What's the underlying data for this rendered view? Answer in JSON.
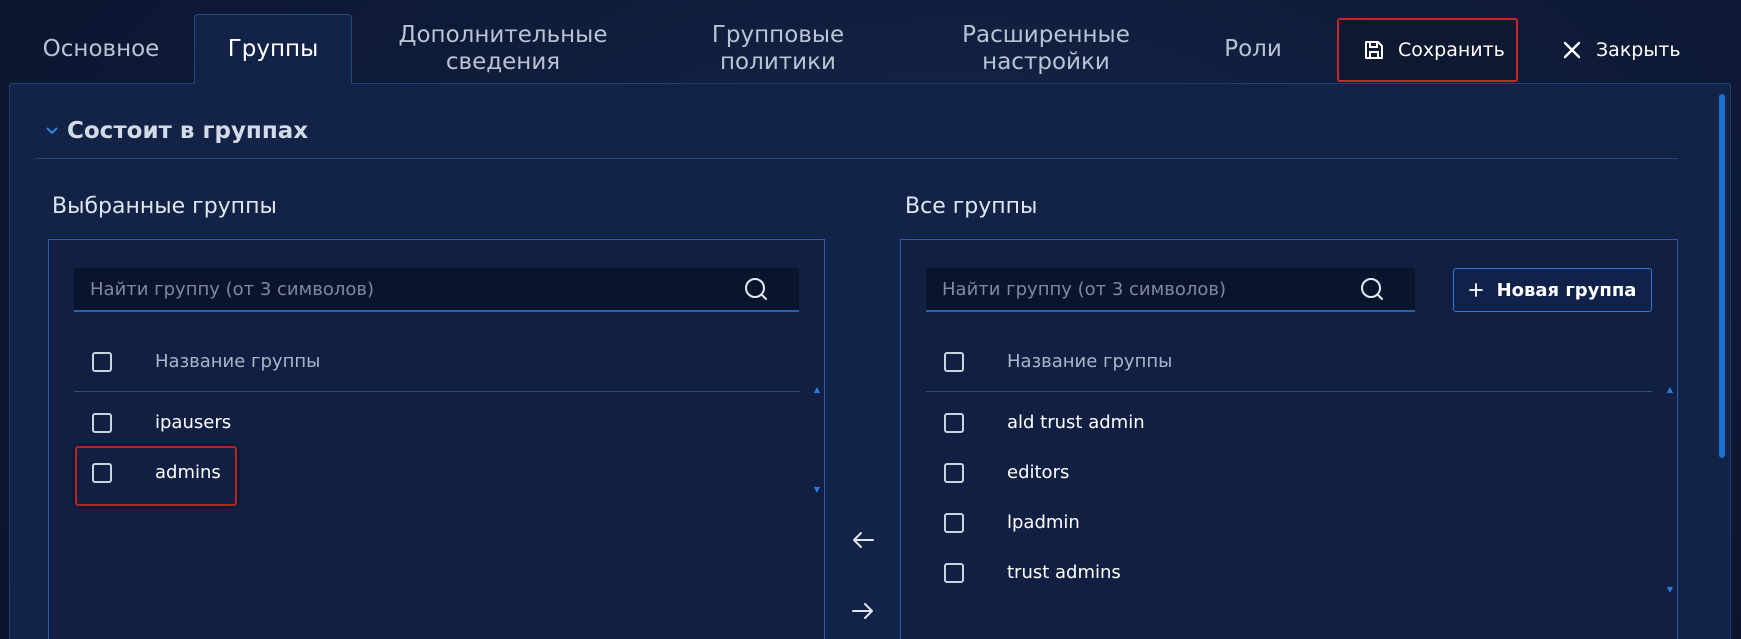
{
  "tabs": [
    {
      "lines": [
        "Основное"
      ]
    },
    {
      "lines": [
        "Группы"
      ],
      "active": true
    },
    {
      "lines": [
        "Дополнительные",
        "сведения"
      ]
    },
    {
      "lines": [
        "Групповые",
        "политики"
      ]
    },
    {
      "lines": [
        "Расширенные",
        "настройки"
      ]
    },
    {
      "lines": [
        "Роли"
      ]
    }
  ],
  "actions": {
    "save_label": "Сохранить",
    "close_label": "Закрыть"
  },
  "section": {
    "title": "Состоит в группах"
  },
  "selected": {
    "title": "Выбранные группы",
    "search_placeholder": "Найти группу (от 3 символов)",
    "column_header": "Название группы",
    "rows": [
      "ipausers",
      "admins"
    ]
  },
  "all": {
    "title": "Все группы",
    "search_placeholder": "Найти группу (от 3 символов)",
    "new_group_label": "Новая группа",
    "column_header": "Название группы",
    "rows": [
      "ald trust admin",
      "editors",
      "lpadmin",
      "trust admins"
    ]
  },
  "colors": {
    "accent": "#2c79d8",
    "highlight": "#c3292b",
    "background": "#0e1b38"
  },
  "icons": {
    "save": "floppy-disk-icon",
    "close": "close-x-icon",
    "search": "magnifier-icon",
    "plus": "plus-icon",
    "chevron": "chevron-down-icon",
    "arrow_left": "arrow-left-icon",
    "arrow_right": "arrow-right-icon"
  }
}
